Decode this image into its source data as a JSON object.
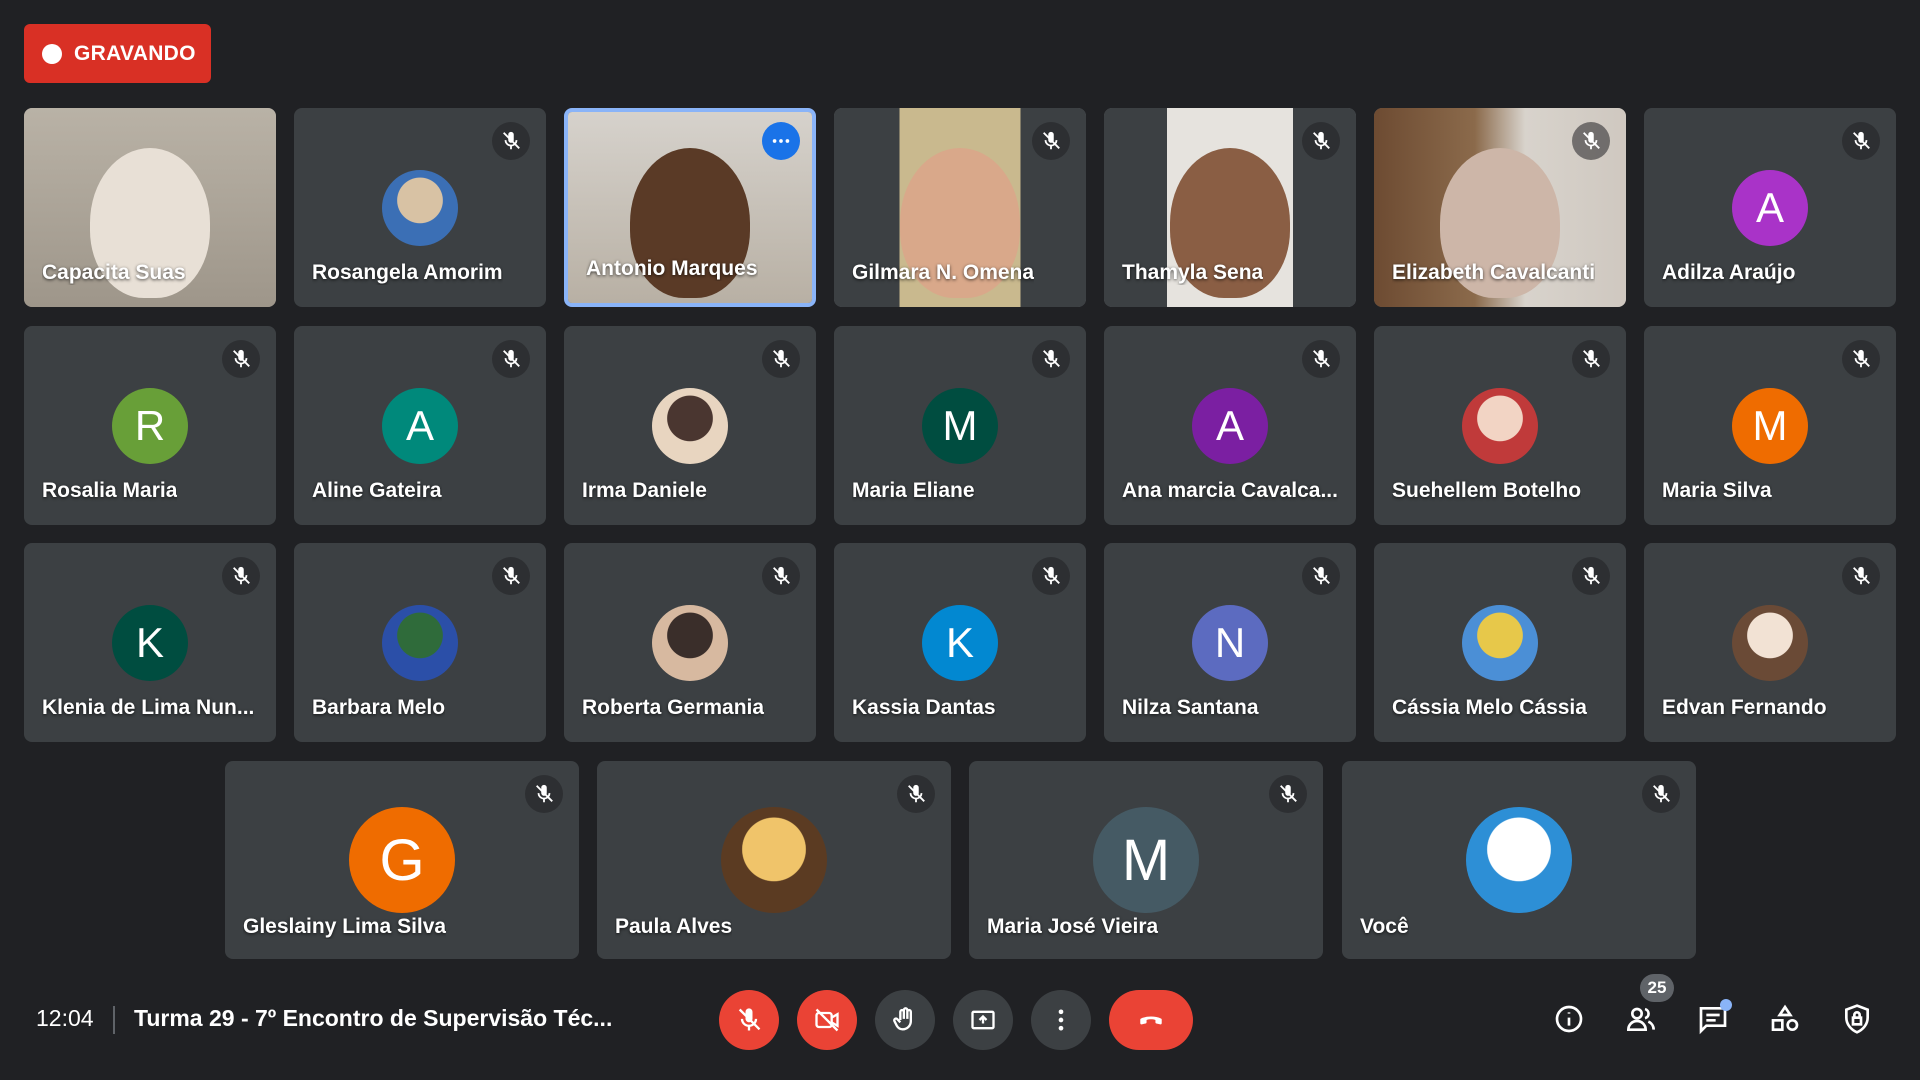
{
  "recording": {
    "label": "GRAVANDO"
  },
  "tiles": [
    {
      "name": "Capacita Suas",
      "muted": false,
      "type": "video"
    },
    {
      "name": "Rosangela Amorim",
      "muted": true,
      "type": "photo"
    },
    {
      "name": "Antonio Marques",
      "muted": false,
      "type": "video",
      "active": true
    },
    {
      "name": "Gilmara N. Omena",
      "muted": true,
      "type": "video"
    },
    {
      "name": "Thamyla Sena",
      "muted": true,
      "type": "video"
    },
    {
      "name": "Elizabeth Cavalcanti",
      "muted": true,
      "type": "video"
    },
    {
      "name": "Adilza Araújo",
      "muted": true,
      "type": "letter",
      "initial": "A",
      "color": "#a933c8"
    },
    {
      "name": "Rosalia Maria",
      "muted": true,
      "type": "letter",
      "initial": "R",
      "color": "#689f38"
    },
    {
      "name": "Aline Gateira",
      "muted": true,
      "type": "letter",
      "initial": "A",
      "color": "#00897b"
    },
    {
      "name": "Irma Daniele",
      "muted": true,
      "type": "photo"
    },
    {
      "name": "Maria Eliane",
      "muted": true,
      "type": "letter",
      "initial": "M",
      "color": "#004d40"
    },
    {
      "name": "Ana marcia Cavalca...",
      "muted": true,
      "type": "letter",
      "initial": "A",
      "color": "#7b1fa2"
    },
    {
      "name": "Suehellem Botelho",
      "muted": true,
      "type": "photo"
    },
    {
      "name": "Maria Silva",
      "muted": true,
      "type": "letter",
      "initial": "M",
      "color": "#ef6c00"
    },
    {
      "name": "Klenia de Lima Nun...",
      "muted": true,
      "type": "letter",
      "initial": "K",
      "color": "#004d40"
    },
    {
      "name": "Barbara Melo",
      "muted": true,
      "type": "photo"
    },
    {
      "name": "Roberta Germania",
      "muted": true,
      "type": "photo"
    },
    {
      "name": "Kassia Dantas",
      "muted": true,
      "type": "letter",
      "initial": "K",
      "color": "#0288d1"
    },
    {
      "name": "Nilza Santana",
      "muted": true,
      "type": "letter",
      "initial": "N",
      "color": "#5c6bc0"
    },
    {
      "name": "Cássia Melo Cássia",
      "muted": true,
      "type": "photo"
    },
    {
      "name": "Edvan Fernando",
      "muted": true,
      "type": "photo"
    },
    {
      "name": "Gleslainy Lima Silva",
      "muted": true,
      "type": "letter",
      "initial": "G",
      "color": "#ef6c00"
    },
    {
      "name": "Paula Alves",
      "muted": true,
      "type": "photo"
    },
    {
      "name": "Maria José Vieira",
      "muted": true,
      "type": "letter",
      "initial": "M",
      "color": "#455a64"
    },
    {
      "name": "Você",
      "muted": true,
      "type": "photo"
    }
  ],
  "bottom_bar": {
    "time": "12:04",
    "meeting_title": "Turma 29 - 7º Encontro de Supervisão Téc...",
    "participant_count": "25",
    "controls": [
      "mic-off-icon",
      "camera-off-icon",
      "raise-hand-icon",
      "present-icon",
      "more-options-icon",
      "end-call-icon"
    ],
    "right_icons": [
      "info-icon",
      "people-icon",
      "chat-icon",
      "activities-icon",
      "host-controls-icon"
    ]
  }
}
